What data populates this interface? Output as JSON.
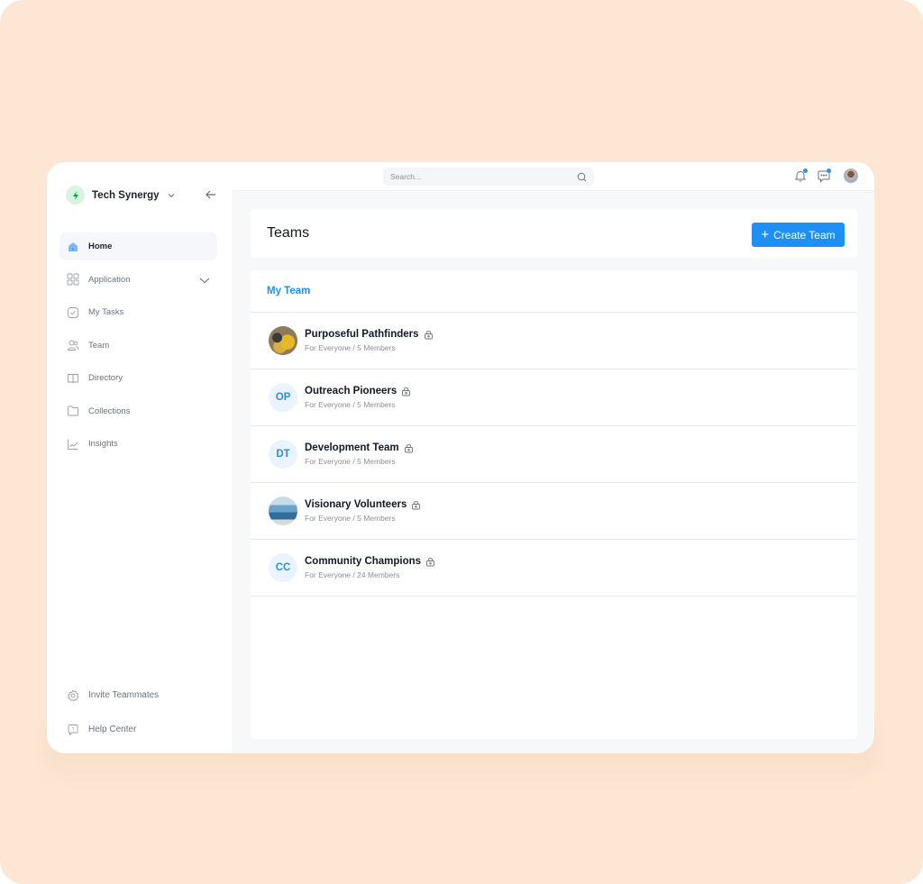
{
  "colors": {
    "accent": "#1e90f5",
    "backdrop": "#fde6d3",
    "brand_green": "#22c55e"
  },
  "sidebar": {
    "workspace_name": "Tech Synergy",
    "items": [
      {
        "label": "Home",
        "icon": "home-icon",
        "active": true
      },
      {
        "label": "Application",
        "icon": "grid-icon",
        "expandable": true
      },
      {
        "label": "My Tasks",
        "icon": "checkbox-icon"
      },
      {
        "label": "Team",
        "icon": "users-icon"
      },
      {
        "label": "Directory",
        "icon": "book-icon"
      },
      {
        "label": "Collections",
        "icon": "folder-icon"
      },
      {
        "label": "Insights",
        "icon": "chart-icon"
      }
    ],
    "bottom_items": [
      {
        "label": "Invite Teammates",
        "icon": "gear-icon"
      },
      {
        "label": "Help Center",
        "icon": "help-chat-icon"
      }
    ]
  },
  "topbar": {
    "search_placeholder": "Search..."
  },
  "main": {
    "title": "Teams",
    "create_button": "Create Team",
    "section_title": "My Team",
    "teams": [
      {
        "name": "Purposeful Pathfinders",
        "meta": "For Everyone / 5 Members",
        "avatar_type": "photo",
        "initials": ""
      },
      {
        "name": "Outreach Pioneers",
        "meta": "For Everyone / 5 Members",
        "avatar_type": "initials",
        "initials": "OP"
      },
      {
        "name": "Development Team",
        "meta": "For Everyone / 5 Members",
        "avatar_type": "initials",
        "initials": "DT"
      },
      {
        "name": "Visionary Volunteers",
        "meta": "For Everyone / 5 Members",
        "avatar_type": "photo",
        "initials": ""
      },
      {
        "name": "Community Champions",
        "meta": "For Everyone / 24 Members",
        "avatar_type": "initials",
        "initials": "CC"
      }
    ]
  }
}
